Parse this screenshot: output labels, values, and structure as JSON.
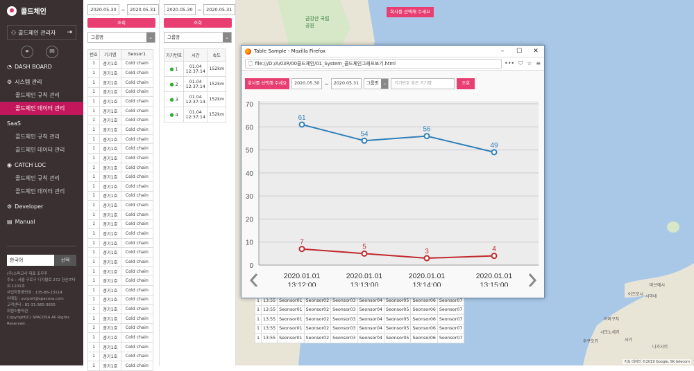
{
  "sidebar": {
    "brand": "콜드체인",
    "user": "콜드체인 관리자",
    "menu": [
      {
        "label": "DASH BOARD",
        "type": "top"
      },
      {
        "label": "시스템 관리",
        "type": "top"
      },
      {
        "label": "콜드체인 규칙 관리",
        "type": "sub"
      },
      {
        "label": "콜드체인 데이터 관리",
        "type": "sub-active"
      },
      {
        "label": "SaaS",
        "type": "top"
      },
      {
        "label": "콜드체인 규칙 관리",
        "type": "sub"
      },
      {
        "label": "콜드체인 데이터 관리",
        "type": "sub"
      },
      {
        "label": "CATCH LOC",
        "type": "top"
      },
      {
        "label": "콜드체인 규칙 관리",
        "type": "sub"
      },
      {
        "label": "콜드체인 데이터 관리",
        "type": "sub"
      },
      {
        "label": "Developer",
        "type": "top"
      },
      {
        "label": "Manual",
        "type": "top"
      }
    ],
    "lang_value": "한국어",
    "lang_select": "선택",
    "footer": [
      "(주)스파코사 대표 조무주",
      "주소 : 서울 구로구 디지털로 272 한신IT타워 1101호",
      "사업자등록번호 : 135-86-23114",
      "이메일 : surport@spacosa.com",
      "고객센터 : 82-31-360-3655",
      "회원이용약관",
      "Copyright(C) SPACOSA All Rights Reserved."
    ]
  },
  "panel1": {
    "date_from": "2020.05.30",
    "tilde": "~",
    "date_to": "2020.05.31",
    "search_label": "조회",
    "group_select": "그룹명",
    "headers": [
      "번호",
      "기기명",
      "Sensor1"
    ],
    "row": [
      "1",
      "경기1호",
      "Cold chain"
    ]
  },
  "panel2": {
    "date_from": "2020.05.30",
    "tilde": "~",
    "date_to": "2020.05.31",
    "search_label": "조회",
    "group_select": "그룹명",
    "headers": [
      "기기번호",
      "시간",
      "속도"
    ],
    "rows": [
      {
        "no": "1",
        "date": "01.04",
        "time": "12:37:14",
        "speed": "152km"
      },
      {
        "no": "2",
        "date": "01.04",
        "time": "12:37:14",
        "speed": "152km"
      },
      {
        "no": "3",
        "date": "01.04",
        "time": "12:37:14",
        "speed": "152km"
      },
      {
        "no": "4",
        "date": "01.04",
        "time": "12:37:14",
        "speed": "152km"
      }
    ]
  },
  "map": {
    "top_button": "회사를 선택해 주세요",
    "labels": [
      "금강산 국립공원",
      "시마네",
      "마쓰에시",
      "이즈모시",
      "야마구치",
      "시모노세키",
      "후쿠오카",
      "사가",
      "나가사키"
    ],
    "attribution": "지도 데이터 ©2019 Google, SK telecom",
    "table_rows": [
      [
        "1",
        "13:55",
        "Seonsor01",
        "Seonsor02",
        "Seonsor03",
        "Seonsor04",
        "Seonsor05",
        "Seonsor06",
        "Seonsor07"
      ]
    ]
  },
  "popup": {
    "title": "Table Sample - Mozilla Firefox",
    "url": "file:///D:/A/03R/00콜드체인/01_System_콜드체인그래프보기.html",
    "company_button": "회사를 선택해 주세요",
    "date_from": "2020.05.30",
    "tilde": "~",
    "date_to": "2020.05.31",
    "group_select": "그룹명",
    "search_placeholder": "기기번호 혹은 기기명",
    "search_label": "조회"
  },
  "chart_data": {
    "type": "line",
    "categories": [
      "2020.01.01 13:12:00",
      "2020.01.01 13:13:00",
      "2020.01.01 13:14:00",
      "2020.01.01 13:15:00"
    ],
    "series": [
      {
        "values": [
          61,
          54,
          56,
          49
        ],
        "color": "#2e7fb8"
      },
      {
        "values": [
          7,
          5,
          3,
          4
        ],
        "color": "#c0282d"
      }
    ],
    "ylim": [
      0,
      70
    ],
    "yticks": [
      0,
      10,
      20,
      30,
      40,
      50,
      60,
      70
    ],
    "grid": true,
    "xlabel": "",
    "ylabel": ""
  }
}
